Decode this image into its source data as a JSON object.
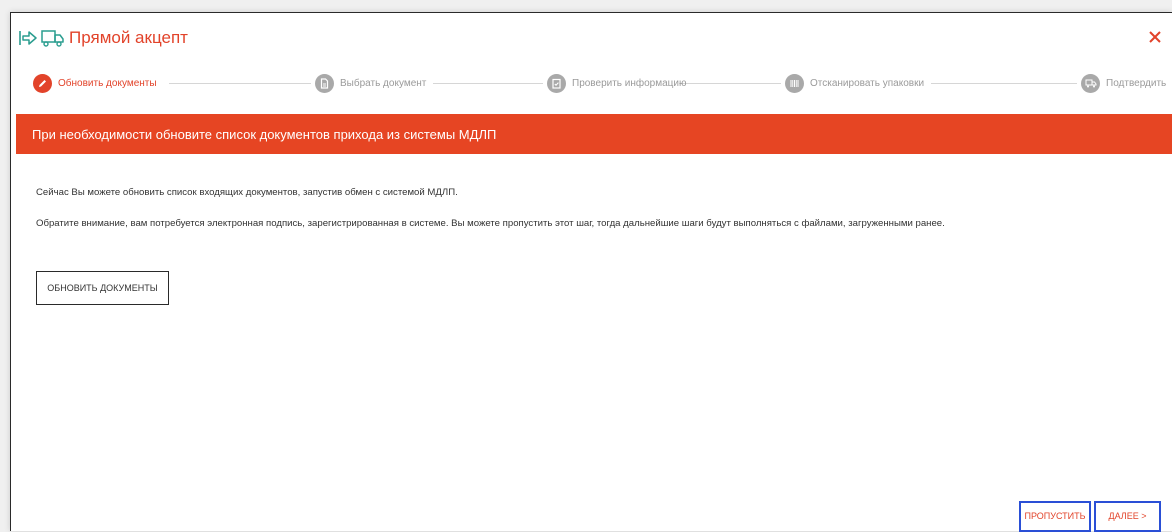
{
  "window": {
    "title": "Прямой акцепт",
    "accent_color": "#e2432a",
    "icons": [
      "transfer-arrow-icon",
      "truck-icon",
      "close-icon"
    ]
  },
  "stepper": {
    "steps": [
      {
        "label": "Обновить документы",
        "icon": "pencil-icon",
        "active": true
      },
      {
        "label": "Выбрать документ",
        "icon": "document-icon",
        "active": false
      },
      {
        "label": "Проверить информацию",
        "icon": "checklist-icon",
        "active": false
      },
      {
        "label": "Отсканировать упаковки",
        "icon": "barcode-icon",
        "active": false
      },
      {
        "label": "Подтвердить",
        "icon": "truck-icon",
        "active": false
      }
    ]
  },
  "banner": {
    "text": "При необходимости обновите список документов прихода из системы МДЛП",
    "color": "#e64523"
  },
  "content": {
    "line1": "Сейчас Вы можете обновить список входящих документов, запустив обмен с системой МДЛП.",
    "line2": "Обратите внимание, вам потребуется электронная подпись, зарегистрированная в системе. Вы можете пропустить этот шаг, тогда дальнейшие шаги будут выполняться с файлами, загруженными ранее.",
    "update_button": "ОБНОВИТЬ ДОКУМЕНТЫ"
  },
  "footer": {
    "skip_button": "ПРОПУСТИТЬ",
    "next_button": "ДАЛЕЕ >",
    "highlight_color": "#2a4fd6"
  }
}
